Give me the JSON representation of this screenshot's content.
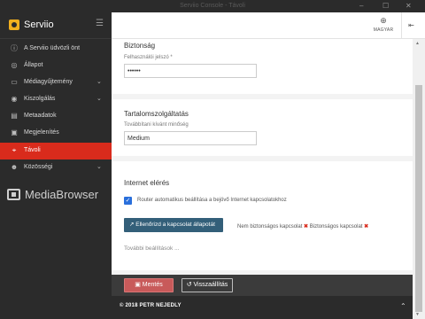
{
  "window": {
    "title": "Serviio Console - Távoli"
  },
  "brand": {
    "name": "Serviio",
    "menu_icon": "hamburger-icon"
  },
  "sidebar": {
    "items": [
      {
        "label": "A Serviio üdvözli önt",
        "icon": "info-icon",
        "active": false,
        "expandable": false
      },
      {
        "label": "Állapot",
        "icon": "status-icon",
        "active": false,
        "expandable": false
      },
      {
        "label": "Médiagyűjtemény",
        "icon": "folder-icon",
        "active": false,
        "expandable": true
      },
      {
        "label": "Kiszolgálás",
        "icon": "broadcast-icon",
        "active": false,
        "expandable": true
      },
      {
        "label": "Metaadatok",
        "icon": "metadata-icon",
        "active": false,
        "expandable": false
      },
      {
        "label": "Megjelenítés",
        "icon": "display-icon",
        "active": false,
        "expandable": false
      },
      {
        "label": "Távoli",
        "icon": "remote-icon",
        "active": true,
        "expandable": false
      },
      {
        "label": "Közösségi",
        "icon": "community-icon",
        "active": false,
        "expandable": true
      }
    ],
    "partner_logo": "MediaBrowser"
  },
  "topbar": {
    "language_code": "MAGYAR",
    "language_icon": "globe-icon",
    "collapse_icon": "collapse-icon"
  },
  "security": {
    "title": "Biztonság",
    "password_label": "Felhasználói jelszó *",
    "password_value": "••••••"
  },
  "content_service": {
    "title": "Tartalomszolgáltatás",
    "quality_label": "Továbbítani kívánt minőség",
    "quality_value": "Medium"
  },
  "internet": {
    "title": "Internet elérés",
    "router_checkbox_label": "Router automatikus beállítása a bejövő Internet kapcsolatokhoz",
    "router_checked": true,
    "check_button_label": "Ellenőrizd a kapcsolat állapotát",
    "status_prefix": "Nem biztonságos kapcsolat",
    "status_suffix": "Biztonságos kapcsolat",
    "more_settings": "További beállítások ..."
  },
  "actions": {
    "save_label": "Mentés",
    "reset_label": "Visszaállítás"
  },
  "footer": {
    "copyright": "© 2018 PETR NEJEDLY"
  },
  "colors": {
    "accent": "#d92b1c",
    "brand_yellow": "#f2b01e",
    "sidebar_bg": "#2b2b2b",
    "check_button": "#335f79",
    "checkbox": "#2a6fdb"
  }
}
